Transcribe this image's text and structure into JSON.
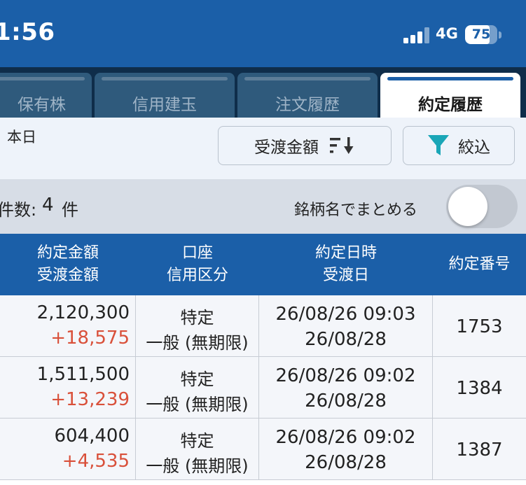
{
  "status": {
    "time": "1:56",
    "network": "4G",
    "battery": "75",
    "battery_level": 0.75
  },
  "tabs": [
    {
      "label": "保有株",
      "active": false
    },
    {
      "label": "信用建玉",
      "active": false
    },
    {
      "label": "注文履歴",
      "active": false
    },
    {
      "label": "約定履歴",
      "active": true
    }
  ],
  "filter": {
    "date_label": "本日",
    "sort_label": "受渡金額",
    "sort_icon": "sort-descending-icon",
    "filter_label": "絞込",
    "filter_icon": "funnel-icon"
  },
  "summary": {
    "count_label": "件数:",
    "count_value": "4",
    "count_unit": "件",
    "group_label": "銘柄名でまとめる",
    "group_toggle_on": false
  },
  "table": {
    "headers": [
      {
        "line1": "約定金額",
        "line2": "受渡金額"
      },
      {
        "line1": "口座",
        "line2": "信用区分"
      },
      {
        "line1": "約定日時",
        "line2": "受渡日"
      },
      {
        "line1": "約定番号",
        "line2": ""
      }
    ],
    "rows": [
      {
        "amount": "2,120,300",
        "settlement": "+18,575",
        "account": "特定",
        "credit": "一般 (無期限)",
        "trade_datetime": "26/08/26 09:03",
        "settle_date": "26/08/28",
        "trade_no": "1753"
      },
      {
        "amount": "1,511,500",
        "settlement": "+13,239",
        "account": "特定",
        "credit": "一般 (無期限)",
        "trade_datetime": "26/08/26 09:02",
        "settle_date": "26/08/28",
        "trade_no": "1384"
      },
      {
        "amount": "604,400",
        "settlement": "+4,535",
        "account": "特定",
        "credit": "一般 (無期限)",
        "trade_datetime": "26/08/26 09:02",
        "settle_date": "26/08/28",
        "trade_no": "1387"
      }
    ]
  },
  "colors": {
    "brand_blue": "#1b5fa8",
    "tab_dark": "#0f2d4a",
    "profit_red": "#d9503a",
    "filter_teal": "#1aa6b7"
  }
}
